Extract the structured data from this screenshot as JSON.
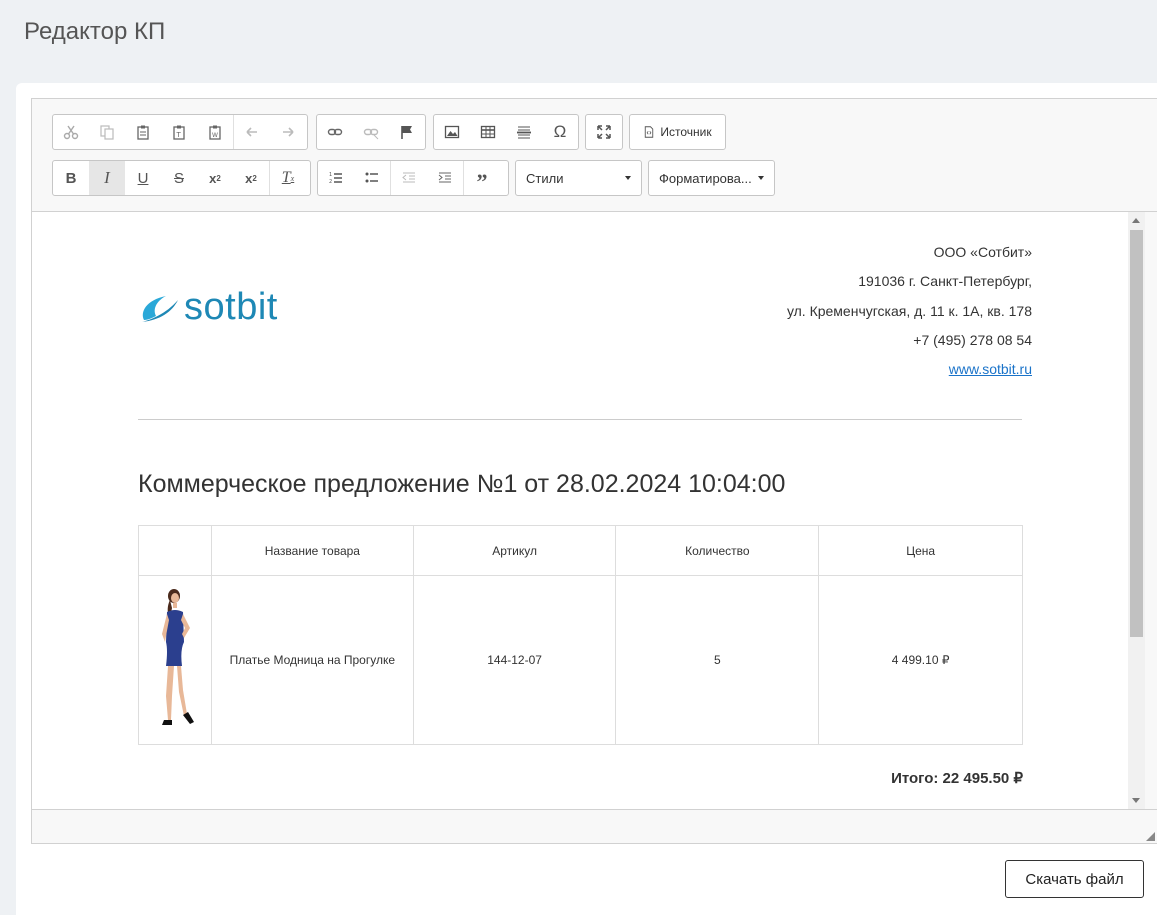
{
  "page": {
    "title": "Редактор КП"
  },
  "toolbar": {
    "source_label": "Источник",
    "styles_label": "Стили",
    "format_label": "Форматирова..."
  },
  "company": {
    "name": "ООО «Сотбит»",
    "city": "191036 г. Санкт-Петербург,",
    "street": "ул. Кременчугская, д. 11 к. 1А, кв. 178",
    "phone": "+7 (495) 278 08 54",
    "website": "www.sotbit.ru"
  },
  "logo": {
    "text": "sotbit",
    "color": "#1e88b5"
  },
  "document": {
    "title": "Коммерческое предложение №1 от 28.02.2024 10:04:00"
  },
  "table": {
    "headers": [
      "",
      "Название товара",
      "Артикул",
      "Количество",
      "Цена"
    ],
    "rows": [
      {
        "name": "Платье Модница на Прогулке",
        "sku": "144-12-07",
        "qty": "5",
        "price": "4 499.10 ₽"
      }
    ]
  },
  "total": "Итого: 22 495.50 ₽",
  "actions": {
    "download_label": "Скачать файл"
  }
}
